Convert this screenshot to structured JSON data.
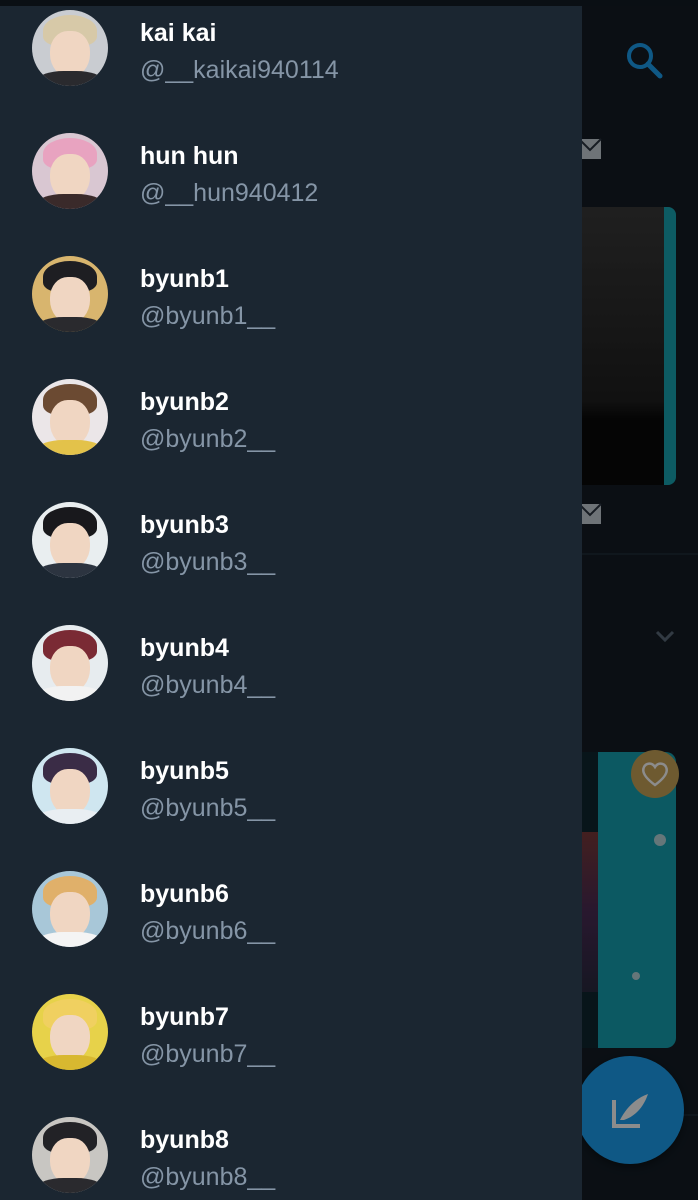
{
  "colors": {
    "drawer_bg": "#1b2631",
    "timeline_bg": "#141d26",
    "accent": "#1da1f2",
    "teal_media": "#17a3b2",
    "name_text": "#ffffff",
    "handle_text": "#8595a6"
  },
  "background": {
    "search_icon": "search-icon",
    "mail_icon": "mail-icon",
    "chevron_icon": "chevron-down-icon",
    "like_icon": "heart-icon",
    "compose_icon": "compose-tweet-icon"
  },
  "accounts": [
    {
      "name": "kai kai",
      "handle": "@__kaikai940114",
      "avatar": {
        "bg": "#c9ccd1",
        "hair": "#d7c9a8",
        "shirt": "#2a2a2e"
      }
    },
    {
      "name": "hun hun",
      "handle": "@__hun940412",
      "avatar": {
        "bg": "#d9c7d2",
        "hair": "#e8a3c0",
        "shirt": "#3a2a2a"
      }
    },
    {
      "name": "byunb1",
      "handle": "@byunb1__",
      "avatar": {
        "bg": "#d8b56e",
        "hair": "#1e1e22",
        "shirt": "#2a2a2e"
      }
    },
    {
      "name": "byunb2",
      "handle": "@byunb2__",
      "avatar": {
        "bg": "#ebe6e8",
        "hair": "#6b4a32",
        "shirt": "#e3c24a"
      }
    },
    {
      "name": "byunb3",
      "handle": "@byunb3__",
      "avatar": {
        "bg": "#e9eef0",
        "hair": "#18181c",
        "shirt": "#2c3440"
      }
    },
    {
      "name": "byunb4",
      "handle": "@byunb4__",
      "avatar": {
        "bg": "#e7ecef",
        "hair": "#7a2a34",
        "shirt": "#f2f2f2"
      }
    },
    {
      "name": "byunb5",
      "handle": "@byunb5__",
      "avatar": {
        "bg": "#cfe6f0",
        "hair": "#3a2c46",
        "shirt": "#e9eef2"
      }
    },
    {
      "name": "byunb6",
      "handle": "@byunb6__",
      "avatar": {
        "bg": "#a8c7d8",
        "hair": "#e0b06a",
        "shirt": "#f4f4f4"
      }
    },
    {
      "name": "byunb7",
      "handle": "@byunb7__",
      "avatar": {
        "bg": "#e7d24a",
        "hair": "#f0d060",
        "shirt": "#d8b830"
      }
    },
    {
      "name": "byunb8",
      "handle": "@byunb8__",
      "avatar": {
        "bg": "#c8c6c2",
        "hair": "#222226",
        "shirt": "#2a2a2e"
      }
    }
  ]
}
